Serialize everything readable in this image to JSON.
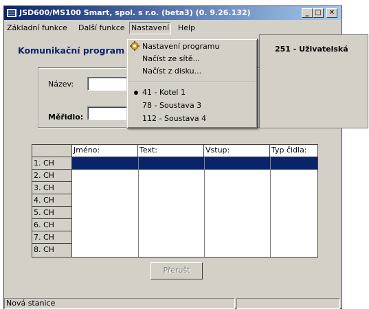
{
  "window": {
    "title": "JSD600/MS100 Smart, spol. s r.o. (beta3)  (0. 9.26.132)",
    "buttons": {
      "minimize": "_",
      "maximize": "□",
      "close": "✕"
    }
  },
  "menubar": {
    "items": [
      "Základní funkce",
      "Další funkce",
      "Nastavení",
      "Help"
    ]
  },
  "main": {
    "heading": "Komunikační program",
    "name_label": "Název:",
    "name_value": "",
    "meter_label": "Měřidlo:",
    "meter_value": ""
  },
  "grid": {
    "columns": [
      "Jméno:",
      "Text:",
      "Vstup:",
      "Typ čidla:"
    ],
    "rows": [
      "1. CH",
      "2. CH",
      "3. CH",
      "4. CH",
      "5. CH",
      "6. CH",
      "7. CH",
      "8. CH"
    ],
    "selected_row": 1
  },
  "stop_button": {
    "label": "Přerušt"
  },
  "statusbar": {
    "text": "Nová stanice",
    "panel2": ""
  },
  "dropdown": {
    "items": [
      {
        "label": "Nastavení programu",
        "icon": "gear-icon"
      },
      {
        "label": "Načíst ze sítě..."
      },
      {
        "label": "Načíst z disku..."
      }
    ],
    "stations": [
      {
        "label": "41 - Kotel 1",
        "checked": true
      },
      {
        "label": "78 - Soustava 3",
        "checked": false
      },
      {
        "label": "112 - Soustava 4",
        "checked": false
      }
    ]
  },
  "side_panel": {
    "text": "251 - Uživatelská"
  },
  "colors": {
    "title_start": "#0a246a",
    "title_end": "#a6caf0",
    "selection": "#0a246a",
    "face": "#d4d0c8"
  }
}
